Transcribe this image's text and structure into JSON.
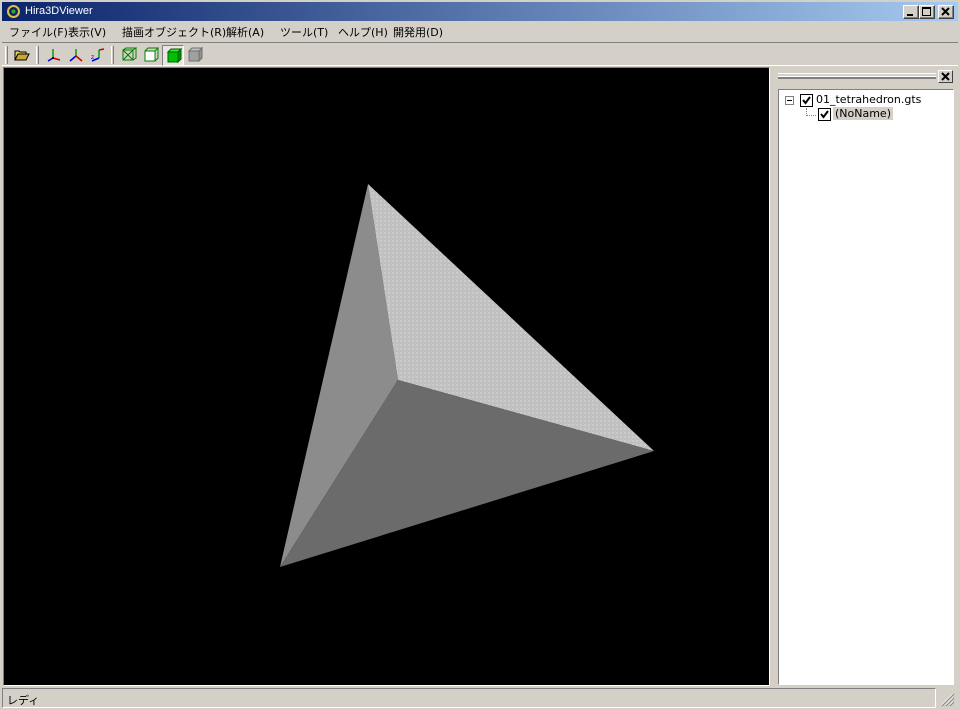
{
  "window": {
    "title": "Hira3DViewer"
  },
  "menubar": {
    "items": [
      {
        "label": "ファイル(F)"
      },
      {
        "label": "表示(V)"
      },
      {
        "label": "描画オブジェクト(R)"
      },
      {
        "label": "解析(A)"
      },
      {
        "label": "ツール(T)"
      },
      {
        "label": "ヘルプ(H)"
      },
      {
        "label": "開発用(D)"
      }
    ]
  },
  "toolbar": {
    "tools": [
      {
        "icon": "open-folder-icon"
      },
      {
        "icon": "view-xy-axis-icon"
      },
      {
        "icon": "view-yz-axis-icon"
      },
      {
        "icon": "view-zx-axis-icon"
      },
      {
        "icon": "wireframe-icon"
      },
      {
        "icon": "hidden-line-icon"
      },
      {
        "icon": "shaded-solid-icon"
      },
      {
        "icon": "shaded-disabled-icon"
      }
    ]
  },
  "tree": {
    "items": [
      {
        "label": "01_tetrahedron.gts",
        "checked": true,
        "expanded": true
      },
      {
        "label": "(NoName)",
        "checked": true,
        "selected": true
      }
    ]
  },
  "status": {
    "text": "レディ"
  },
  "colors": {
    "face_light": "#c0c0c0",
    "face_mid": "#8c8c8c",
    "face_dark": "#6b6b6b",
    "viewport_bg": "#000000"
  }
}
